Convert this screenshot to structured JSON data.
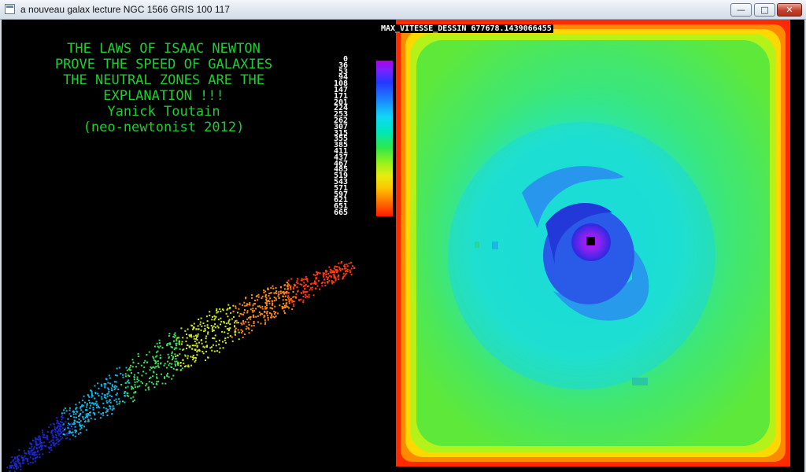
{
  "window": {
    "title": "a nouveau galax lecture NGC 1566 GRIS 100 117",
    "buttons": {
      "minimize": "—",
      "maximize": "□",
      "close": "✕"
    },
    "icon": "app-window-icon"
  },
  "headline": {
    "lines": [
      "THE LAWS OF ISAAC NEWTON",
      "PROVE THE SPEED OF GALAXIES",
      "THE NEUTRAL ZONES ARE THE",
      "EXPLANATION !!!",
      "Yanick Toutain",
      "(neo-newtonist 2012)"
    ],
    "color": "#1ccf2e"
  },
  "color_scale": {
    "labels": [
      "0",
      "36",
      "53",
      "94",
      "108",
      "147",
      "171",
      "201",
      "224",
      "253",
      "262",
      "307",
      "315",
      "355",
      "385",
      "411",
      "437",
      "467",
      "485",
      "519",
      "543",
      "571",
      "597",
      "621",
      "651",
      "665"
    ],
    "colors": [
      "#b000e8",
      "#2438ff",
      "#10d7f7",
      "#2fe84a",
      "#e7ec10",
      "#ff1a00"
    ]
  },
  "max_speed_label": "MAX_VITESSE_DESSIN 677678.1439066455",
  "speed_plot": {
    "description_colors": [
      "#1a28c8",
      "#16b8e8",
      "#3fe05a",
      "#d0e820",
      "#ff8a1a",
      "#ff3a10"
    ]
  },
  "heatmap": {
    "border_colors": [
      "#ff2a00",
      "#ff9a00",
      "#ffe600",
      "#a6f01a",
      "#4ee84a"
    ],
    "field_color": "#4ee84a",
    "halo_color": "#19dcd6",
    "arm_color": "#2a68f0",
    "core_colors": [
      "#2a2ae0",
      "#8a22f0",
      "#d010f0",
      "#000000"
    ]
  }
}
